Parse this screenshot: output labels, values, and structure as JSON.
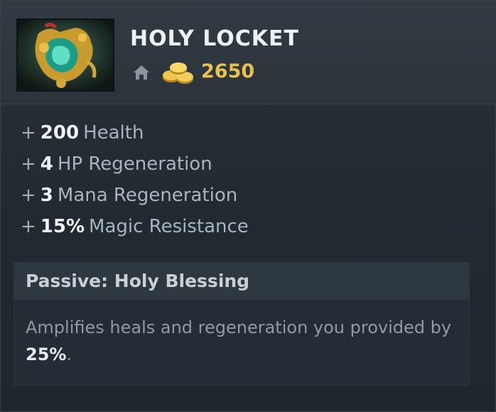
{
  "item": {
    "name": "HOLY LOCKET",
    "cost": "2650",
    "icons": {
      "item": "holy-locket-icon",
      "shop": "home-shop-icon",
      "gold": "gold-coins-icon"
    },
    "colors": {
      "gold": "#e9c14f",
      "value": "#f1f4f6",
      "label": "#aab4bd"
    }
  },
  "stats": [
    {
      "plus": "+",
      "value": "200",
      "label": "Health"
    },
    {
      "plus": "+",
      "value": "4",
      "label": "HP Regeneration"
    },
    {
      "plus": "+",
      "value": "3",
      "label": "Mana Regeneration"
    },
    {
      "plus": "+",
      "value": "15%",
      "label": "Magic Resistance"
    }
  ],
  "ability": {
    "title": "Passive: Holy Blessing",
    "description": "Amplifies heals and regeneration you provided by",
    "amount": "25%",
    "suffix": "."
  }
}
